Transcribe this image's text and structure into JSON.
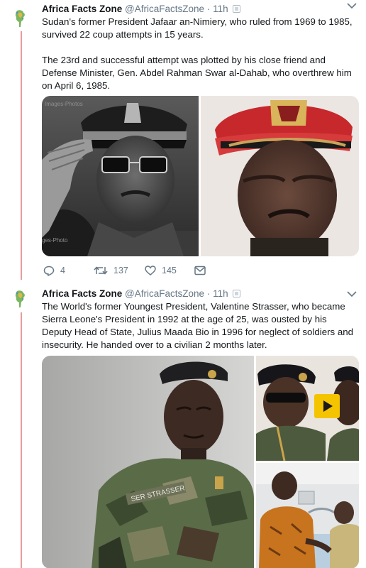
{
  "tweets": [
    {
      "author_name": "Africa Facts Zone",
      "handle": "@AfricaFactsZone",
      "separator": "·",
      "time": "11h",
      "paragraph1": "Sudan's former President Jafaar an-Nimiery, who ruled from 1969 to 1985, survived 22 coup attempts in 15 years.",
      "paragraph2": "The 23rd and successful attempt was plotted by his close friend and Defense Minister, Gen. Abdel Rahman Swar al-Dahab, who overthrew him on April 6, 1985.",
      "replies": "4",
      "retweets": "137",
      "likes": "145"
    },
    {
      "author_name": "Africa Facts Zone",
      "handle": "@AfricaFactsZone",
      "separator": "·",
      "time": "11h",
      "paragraph1": "The World's former Youngest President, Valentine Strasser, who became Sierra Leone's President in 1992 at the age of 25, was ousted by his Deputy Head of State, Julius Maada Bio in 1996 for neglect of soldiers and insecurity. He handed over to a civilian 2 months later."
    }
  ],
  "photos": {
    "photo1_watermark": "Images-Photos",
    "photo1_watermark_bottom": "ges-Photo",
    "photo3_nametape": "SER STRASSER"
  },
  "colors": {
    "thread_line": "#e89aa0",
    "text": "#14171a",
    "secondary": "#657786",
    "play_button": "#f5c400"
  },
  "icons": [
    "avatar-logo-icon",
    "verified-icon",
    "chevron-down-icon",
    "reply-icon",
    "retweet-icon",
    "like-icon",
    "dm-icon",
    "play-icon"
  ]
}
